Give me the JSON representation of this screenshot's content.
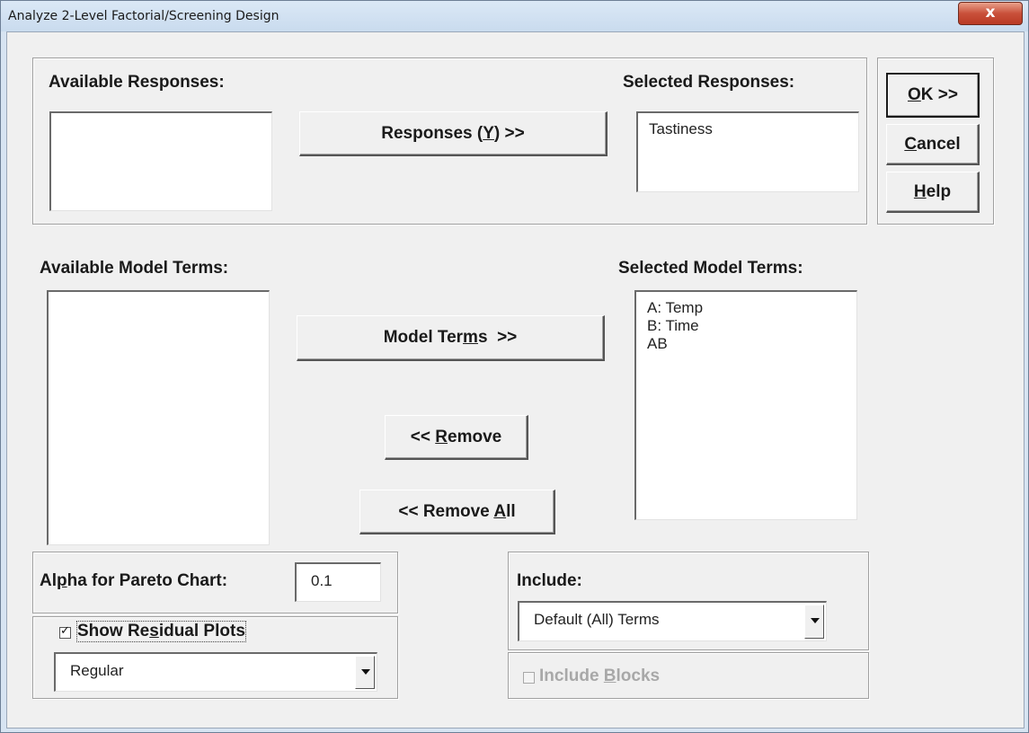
{
  "window": {
    "title": "Analyze 2-Level Factorial/Screening Design",
    "close_glyph": "x"
  },
  "responses": {
    "available_label": "Available Responses:",
    "selected_label": "Selected Responses:",
    "available_items": [],
    "selected_items": [
      "Tastiness"
    ],
    "move_button": "Responses (Y) >>"
  },
  "model_terms": {
    "available_label": "Available Model Terms:",
    "selected_label": "Selected Model Terms:",
    "available_items": [],
    "selected_items": [
      "A: Temp",
      "B: Time",
      "AB"
    ],
    "move_button": "Model Terms >>",
    "remove_button": "<< Remove",
    "remove_all_button": "<< Remove All"
  },
  "dialog_buttons": {
    "ok": "OK >>",
    "cancel": "Cancel",
    "help": "Help"
  },
  "alpha": {
    "label": "Alpha for Pareto Chart:",
    "value": "0.1"
  },
  "residuals": {
    "checkbox_label": "Show Residual Plots",
    "checked": true,
    "plot_type": "Regular"
  },
  "include": {
    "label": "Include:",
    "selected": "Default (All) Terms",
    "blocks_label": "Include Blocks",
    "blocks_checked": false,
    "blocks_enabled": false
  }
}
